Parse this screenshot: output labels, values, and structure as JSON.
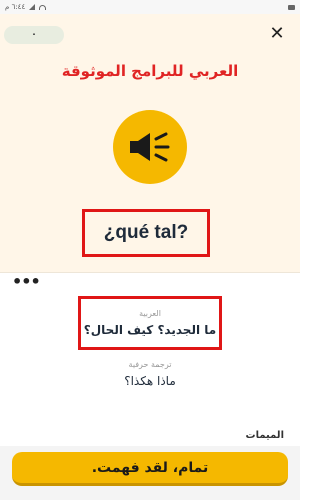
{
  "status_bar": {
    "time": "٦:٤٤ م"
  },
  "header": {
    "progress_text": "٠",
    "close_symbol": "✕"
  },
  "brand": {
    "title": "العربي للبرامج الموثوقة"
  },
  "lesson": {
    "phrase": "¿qué tal?",
    "more_symbol": "•••",
    "translation_label": "العربية",
    "translation_text": "ما الجديد؟ كيف الحال؟",
    "literal_label": "ترجمة حرفية",
    "literal_text": "ماذا هكذا؟",
    "memes_label": "الميمات"
  },
  "footer": {
    "cta_label": "تمام، لقد فهمت."
  },
  "colors": {
    "accent": "#f5b800",
    "highlight": "#e01616",
    "brand_red": "#e02424",
    "cream": "#fff6e8"
  },
  "icons": {
    "speaker": "speaker-icon",
    "close": "close-icon"
  }
}
